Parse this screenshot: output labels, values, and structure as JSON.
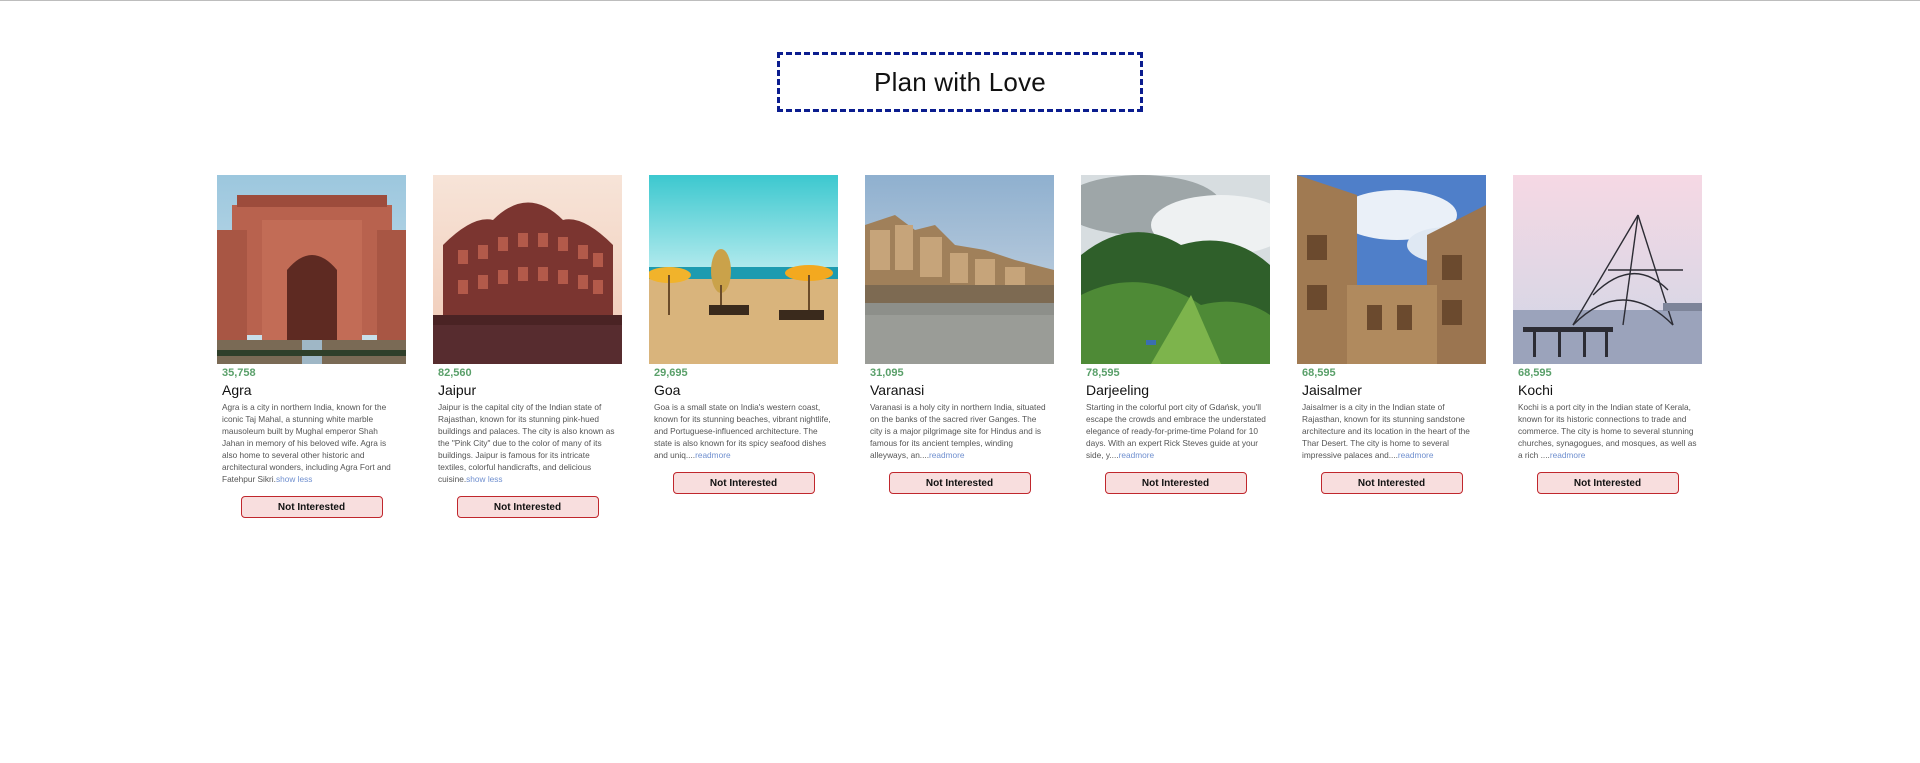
{
  "page": {
    "title": "Plan with Love"
  },
  "cards": [
    {
      "price": "35,758",
      "name": "Agra",
      "desc": "Agra is a city in northern India, known for the iconic Taj Mahal, a stunning white marble mausoleum built by Mughal emperor Shah Jahan in memory of his beloved wife. Agra is also home to several other historic and architectural wonders, including Agra Fort and Fatehpur Sikri.",
      "more": "show less",
      "button": "Not Interested"
    },
    {
      "price": "82,560",
      "name": "Jaipur",
      "desc": "Jaipur is the capital city of the Indian state of Rajasthan, known for its stunning pink-hued buildings and palaces. The city is also known as the \"Pink City\" due to the color of many of its buildings. Jaipur is famous for its intricate textiles, colorful handicrafts, and delicious cuisine.",
      "more": "show less",
      "button": "Not Interested"
    },
    {
      "price": "29,695",
      "name": "Goa",
      "desc": "Goa is a small state on India's western coast, known for its stunning beaches, vibrant nightlife, and Portuguese-influenced architecture. The state is also known for its spicy seafood dishes and uniq....",
      "more": "readmore",
      "button": "Not Interested"
    },
    {
      "price": "31,095",
      "name": "Varanasi",
      "desc": "Varanasi is a holy city in northern India, situated on the banks of the sacred river Ganges. The city is a major pilgrimage site for Hindus and is famous for its ancient temples, winding alleyways, an....",
      "more": "readmore",
      "button": "Not Interested"
    },
    {
      "price": "78,595",
      "name": "Darjeeling",
      "desc": "Starting in the colorful port city of Gdańsk, you'll escape the crowds and embrace the understated elegance of ready-for-prime-time Poland for 10 days. With an expert Rick Steves guide at your side, y....",
      "more": "readmore",
      "button": "Not Interested"
    },
    {
      "price": "68,595",
      "name": "Jaisalmer",
      "desc": "Jaisalmer is a city in the Indian state of Rajasthan, known for its stunning sandstone architecture and its location in the heart of the Thar Desert. The city is home to several impressive palaces and....",
      "more": "readmore",
      "button": "Not Interested"
    },
    {
      "price": "68,595",
      "name": "Kochi",
      "desc": "Kochi is a port city in the Indian state of Kerala, known for its historic connections to trade and commerce. The city is home to several stunning churches, synagogues, and mosques, as well as a rich ....",
      "more": "readmore",
      "button": "Not Interested"
    }
  ]
}
